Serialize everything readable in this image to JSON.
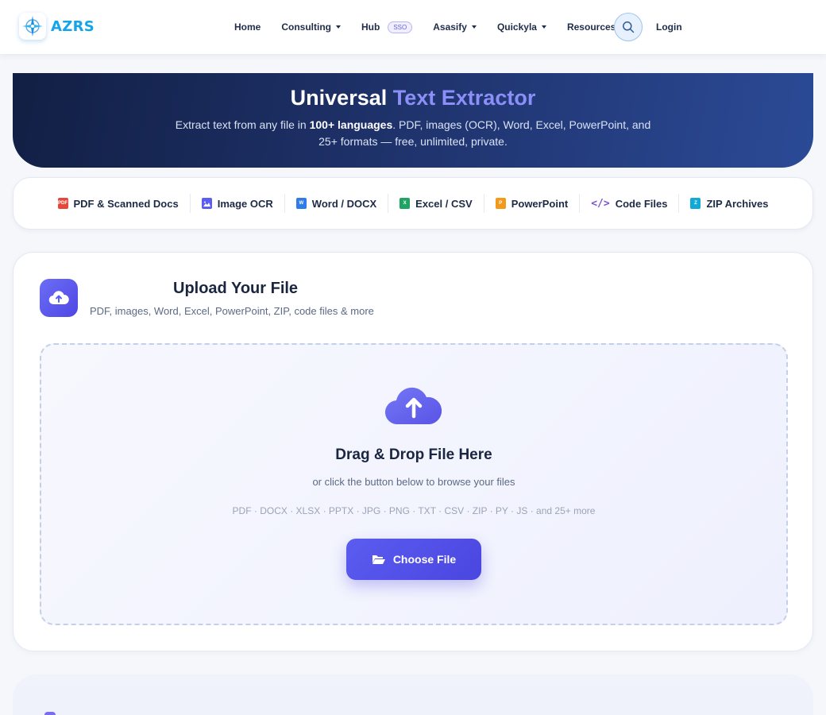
{
  "nav": {
    "brand": "AZRS",
    "links": [
      {
        "label": "Home",
        "dropdown": false
      },
      {
        "label": "Consulting",
        "dropdown": true
      },
      {
        "label": "Hub",
        "badge": "SSO",
        "dropdown": false
      },
      {
        "label": "Asasify",
        "dropdown": true
      },
      {
        "label": "Quickyla",
        "dropdown": true
      },
      {
        "label": "Resources",
        "dropdown": true
      }
    ],
    "search_icon": "search-icon",
    "login": "Login"
  },
  "hero": {
    "title_plain": "Universal",
    "title_accent": "Text Extractor",
    "sub_pre": "Extract text from any file in ",
    "sub_bold": "100+ languages",
    "sub_post": ". PDF, images (OCR), Word, Excel, PowerPoint, and 25+ formats — free, unlimited, private."
  },
  "formats": [
    {
      "label": "PDF & Scanned Docs",
      "icon": "pdf-icon",
      "color": "#e5483b"
    },
    {
      "label": "Image OCR",
      "icon": "image-icon",
      "color": "#5b5cf0"
    },
    {
      "label": "Word / DOCX",
      "icon": "word-icon",
      "color": "#2f7be8"
    },
    {
      "label": "Excel / CSV",
      "icon": "excel-icon",
      "color": "#1fa463"
    },
    {
      "label": "PowerPoint",
      "icon": "powerpoint-icon",
      "color": "#f29a1c"
    },
    {
      "label": "Code Files",
      "icon": "code-icon",
      "color": "#7a52d6"
    },
    {
      "label": "ZIP Archives",
      "icon": "zip-icon",
      "color": "#12a9d6"
    }
  ],
  "upload": {
    "title": "Upload Your File",
    "subtitle": "PDF, images, Word, Excel, PowerPoint, ZIP, code files & more",
    "drop_title": "Drag & Drop File Here",
    "drop_sub": "or click the button below to browse your files",
    "drop_formats": "PDF · DOCX · XLSX · PPTX · JPG · PNG · TXT · CSV · ZIP · PY · JS · and 25+ more",
    "button": "Choose File"
  },
  "colors": {
    "accent": "#5b5cf0",
    "brand": "#14a5e8",
    "hero_dark": "#121f44"
  }
}
